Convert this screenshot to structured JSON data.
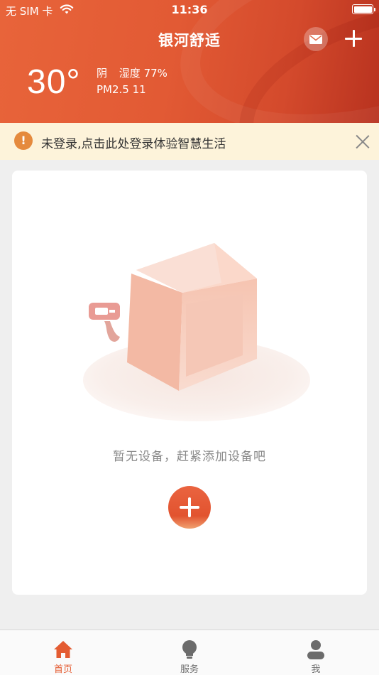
{
  "status_bar": {
    "carrier": "无 SIM 卡",
    "time": "11:36"
  },
  "header": {
    "title": "银河舒适",
    "mail_icon": "mail-icon",
    "add_icon": "plus-icon"
  },
  "weather": {
    "temperature": "30°",
    "condition": "阴",
    "humidity": "湿度 77%",
    "pm25": "PM2.5 11"
  },
  "notice": {
    "icon": "exclamation-icon",
    "text": "未登录,点击此处登录体验智慧生活",
    "close_icon": "close-icon"
  },
  "main": {
    "empty_text": "暂无设备，赶紧添加设备吧",
    "add_icon": "plus-icon"
  },
  "tabbar": {
    "tabs": [
      {
        "label": "首页",
        "icon": "home-icon",
        "active": true
      },
      {
        "label": "服务",
        "icon": "lightbulb-icon",
        "active": false
      },
      {
        "label": "我",
        "icon": "user-icon",
        "active": false
      }
    ]
  },
  "colors": {
    "accent": "#e45c32",
    "header_start": "#e8643a",
    "header_end": "#b8321f",
    "notice_bg": "#fdf3da",
    "notice_icon": "#e58a3d",
    "page_bg": "#efefef"
  }
}
